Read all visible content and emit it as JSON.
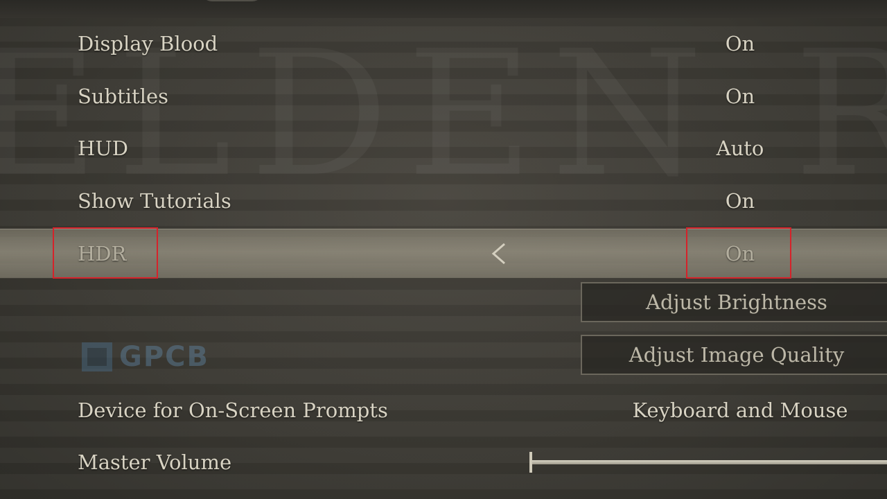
{
  "background_emblem": "ELDEN RING",
  "settings": [
    {
      "label": "Display Blood",
      "value": "On"
    },
    {
      "label": "Subtitles",
      "value": "On"
    },
    {
      "label": "HUD",
      "value": "Auto"
    },
    {
      "label": "Show Tutorials",
      "value": "On"
    },
    {
      "label": "HDR",
      "value": "On",
      "selected": true
    },
    {
      "label": "Device for On-Screen Prompts",
      "value": "Keyboard and Mouse"
    },
    {
      "label": "Master Volume",
      "value": ""
    }
  ],
  "sub_buttons": {
    "adjust_brightness": "Adjust Brightness",
    "adjust_image_quality": "Adjust Image Quality"
  },
  "watermark": "GPCB",
  "colors": {
    "highlight_box": "#d6222a",
    "text": "#d8d3c3",
    "watermark": "#6b9bc4"
  },
  "master_volume_level": 1.0
}
